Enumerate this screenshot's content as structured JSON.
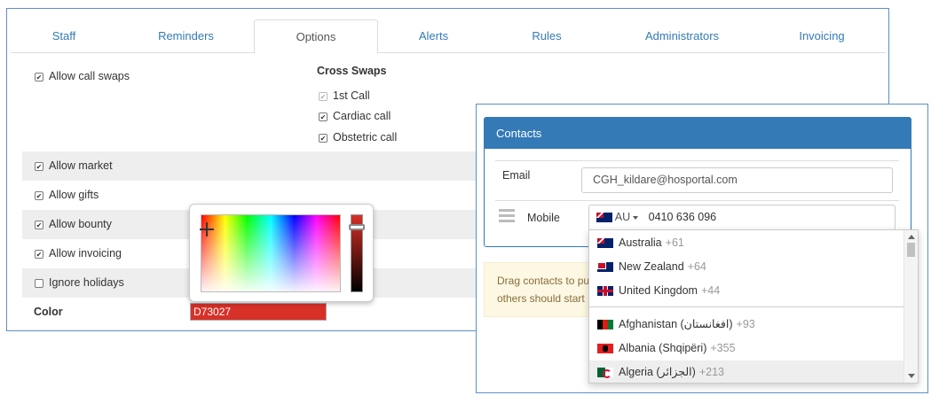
{
  "tabs": [
    "Staff",
    "Reminders",
    "Options",
    "Alerts",
    "Rules",
    "Administrators",
    "Invoicing"
  ],
  "active_tab": "Options",
  "options": {
    "allow_call_swaps": "Allow call swaps",
    "cross_swaps_title": "Cross Swaps",
    "cross_swaps": [
      "1st Call",
      "Cardiac call",
      "Obstetric call"
    ],
    "allow_market": "Allow market",
    "allow_gifts": "Allow gifts",
    "allow_bounty": "Allow bounty",
    "allow_invoicing": "Allow invoicing",
    "ignore_holidays": "Ignore holidays",
    "color_label": "Color",
    "color_value": "D73027",
    "color_hex": "#d73027"
  },
  "contacts": {
    "title": "Contacts",
    "email_label": "Email",
    "email_value": "CGH_kildare@hosportal.com",
    "mobile_label": "Mobile",
    "mobile_country": "AU",
    "mobile_value": "0410 636 096",
    "drag_note_line1": "Drag contacts to pu",
    "drag_note_line2": "others should start",
    "countries": [
      {
        "name": "Australia",
        "dial": "+61",
        "flag": "flag-au"
      },
      {
        "name": "New Zealand",
        "dial": "+64",
        "flag": "flag-nz"
      },
      {
        "name": "United Kingdom",
        "dial": "+44",
        "flag": "flag-uk"
      },
      {
        "name": "Afghanistan (‫افغانستان‬‎)",
        "dial": "+93",
        "flag": "flag-af"
      },
      {
        "name": "Albania (Shqipëri)",
        "dial": "+355",
        "flag": "flag-al"
      },
      {
        "name": "Algeria (‫الجزائر‬‎)",
        "dial": "+213",
        "flag": "flag-dz"
      }
    ]
  }
}
